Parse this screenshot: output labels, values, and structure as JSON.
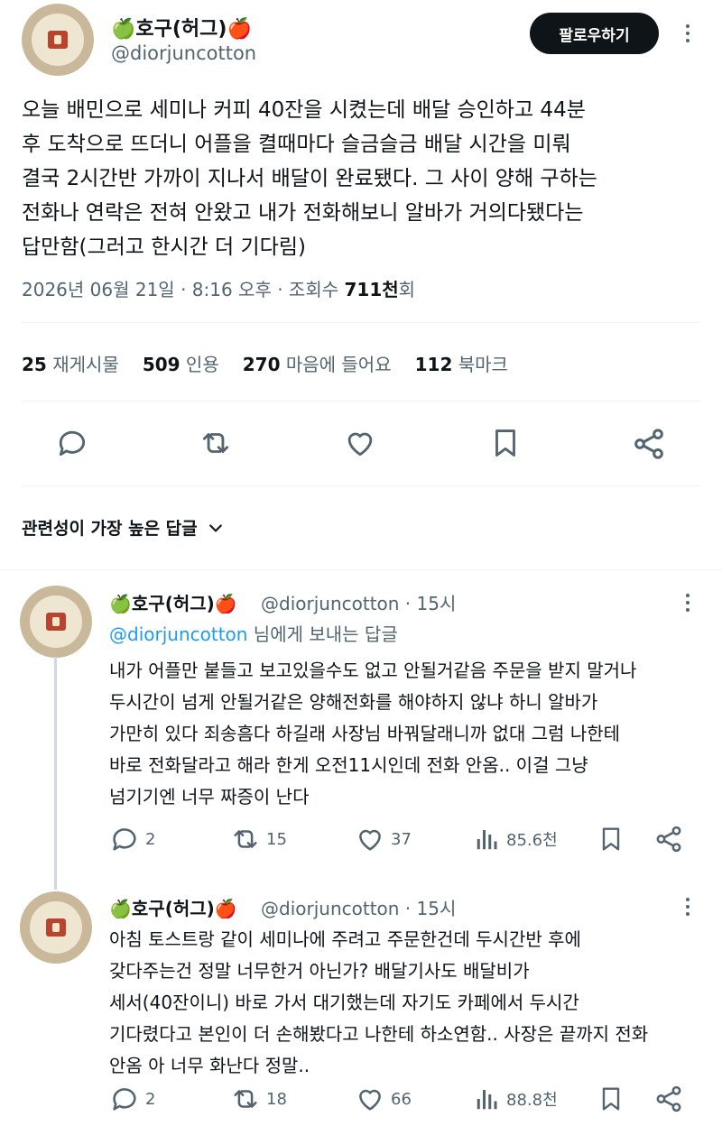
{
  "main_tweet": {
    "author_name": "🍏호구(허그)🍎",
    "handle": "@diorjuncotton",
    "follow_label": "팔로우하기",
    "text_lines": [
      "오늘 배민으로 세미나 커피 40잔을 시켰는데 배달 승인하고 44분",
      "후 도착으로 뜨더니 어플을 켤때마다 슬금슬금 배달 시간을 미뤄",
      "결국 2시간반 가까이 지나서 배달이 완료됐다. 그 사이 양해 구하는",
      "전화나 연락은 전혀 안왔고 내가 전화해보니 알바가 거의다됐다는",
      "답만함(그러고 한시간 더 기다림)"
    ],
    "timestamp": "2026년 06월 21일 · 8:16 오후 · 조회수 ",
    "views_count": "711천",
    "views_suffix": "회",
    "stats": {
      "reposts_count": "25",
      "reposts_label": "재게시물",
      "quotes_count": "509",
      "quotes_label": "인용",
      "likes_count": "270",
      "likes_label": "마음에 들어요",
      "bookmarks_count": "112",
      "bookmarks_label": "북마크"
    }
  },
  "sort": {
    "label": "관련성이 가장 높은 답글"
  },
  "replies": [
    {
      "author_name": "🍏호구(허그)🍎",
      "handle_time": "@diorjuncotton · 15시",
      "reply_to_mention": "@diorjuncotton",
      "reply_to_suffix": " 님에게 보내는 답글",
      "text_lines": [
        "내가 어플만 붙들고 보고있을수도 없고 안될거같음 주문을 받지 말거나",
        "두시간이 넘게 안될거같은 양해전화를 해야하지 않냐 하니 알바가",
        "가만히 있다 죄송흠다 하길래 사장님 바꿔달래니까 없대 그럼 나한테",
        "바로 전화달라고 해라 한게 오전11시인데 전화 안옴.. 이걸 그냥",
        "넘기기엔 너무 짜증이 난다"
      ],
      "replies_count": "2",
      "reposts_count": "15",
      "likes_count": "37",
      "views_count": "85.6천"
    },
    {
      "author_name": "🍏호구(허그)🍎",
      "handle_time": "@diorjuncotton · 15시",
      "text_lines": [
        "아침 토스트랑 같이 세미나에 주려고 주문한건데 두시간반 후에",
        "갖다주는건 정말 너무한거 아닌가? 배달기사도 배달비가",
        "세서(40잔이니) 바로 가서 대기했는데 자기도 카페에서 두시간",
        "기다렸다고 본인이 더 손해봤다고 나한테 하소연함.. 사장은 끝까지 전화",
        "안옴 아 너무 화난다 정말.."
      ],
      "replies_count": "2",
      "reposts_count": "18",
      "likes_count": "66",
      "views_count": "88.8천"
    }
  ]
}
